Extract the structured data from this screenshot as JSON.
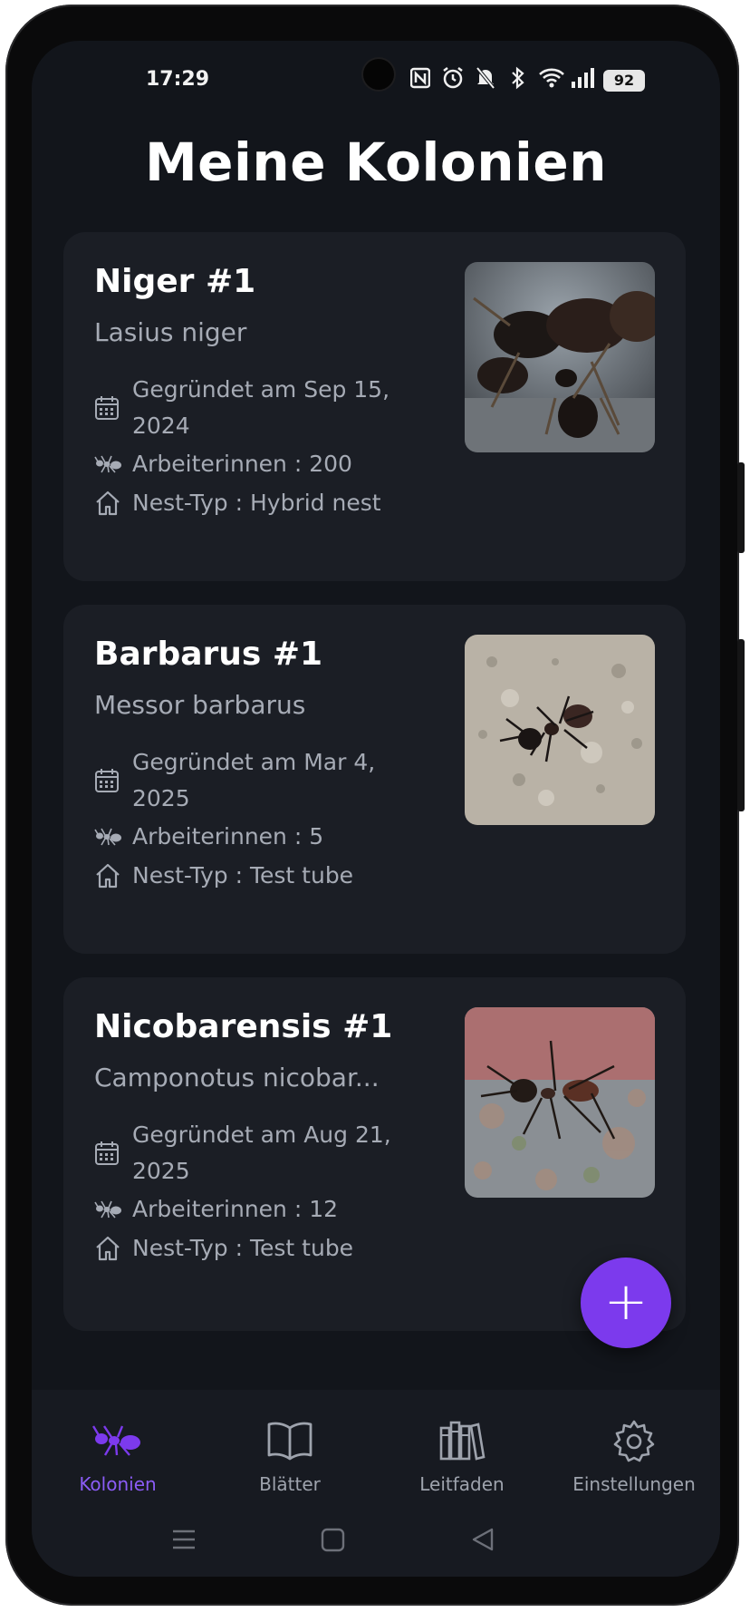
{
  "status_bar": {
    "time": "17:29",
    "battery": "92",
    "icons": [
      "nfc-icon",
      "alarm-icon",
      "bell-off-icon",
      "bluetooth-icon",
      "wifi-icon",
      "signal-icon",
      "battery-icon"
    ]
  },
  "page": {
    "title": "Meine Kolonien"
  },
  "colonies": [
    {
      "name": "Niger #1",
      "species": "Lasius niger",
      "founded": "Gegründet am Sep 15, 2024",
      "workers": "Arbeiterinnen : 200",
      "nest": "Nest-Typ : Hybrid nest"
    },
    {
      "name": "Barbarus #1",
      "species": "Messor barbarus",
      "founded": "Gegründet am Mar 4, 2025",
      "workers": "Arbeiterinnen : 5",
      "nest": "Nest-Typ : Test tube"
    },
    {
      "name": "Nicobarensis #1",
      "species": "Camponotus nicobar...",
      "founded": "Gegründet am Aug 21, 2025",
      "workers": "Arbeiterinnen : 12",
      "nest": "Nest-Typ : Test tube"
    }
  ],
  "fab": {
    "label": "+"
  },
  "bottom_nav": {
    "items": [
      {
        "label": "Kolonien",
        "icon": "ant-icon",
        "active": true
      },
      {
        "label": "Blätter",
        "icon": "book-icon",
        "active": false
      },
      {
        "label": "Leitfaden",
        "icon": "library-icon",
        "active": false
      },
      {
        "label": "Einstellungen",
        "icon": "gear-icon",
        "active": false
      }
    ]
  },
  "colors": {
    "background": "#12151b",
    "card": "#1b1e25",
    "accent": "#7c3aed",
    "text_secondary": "#a6abb5"
  }
}
